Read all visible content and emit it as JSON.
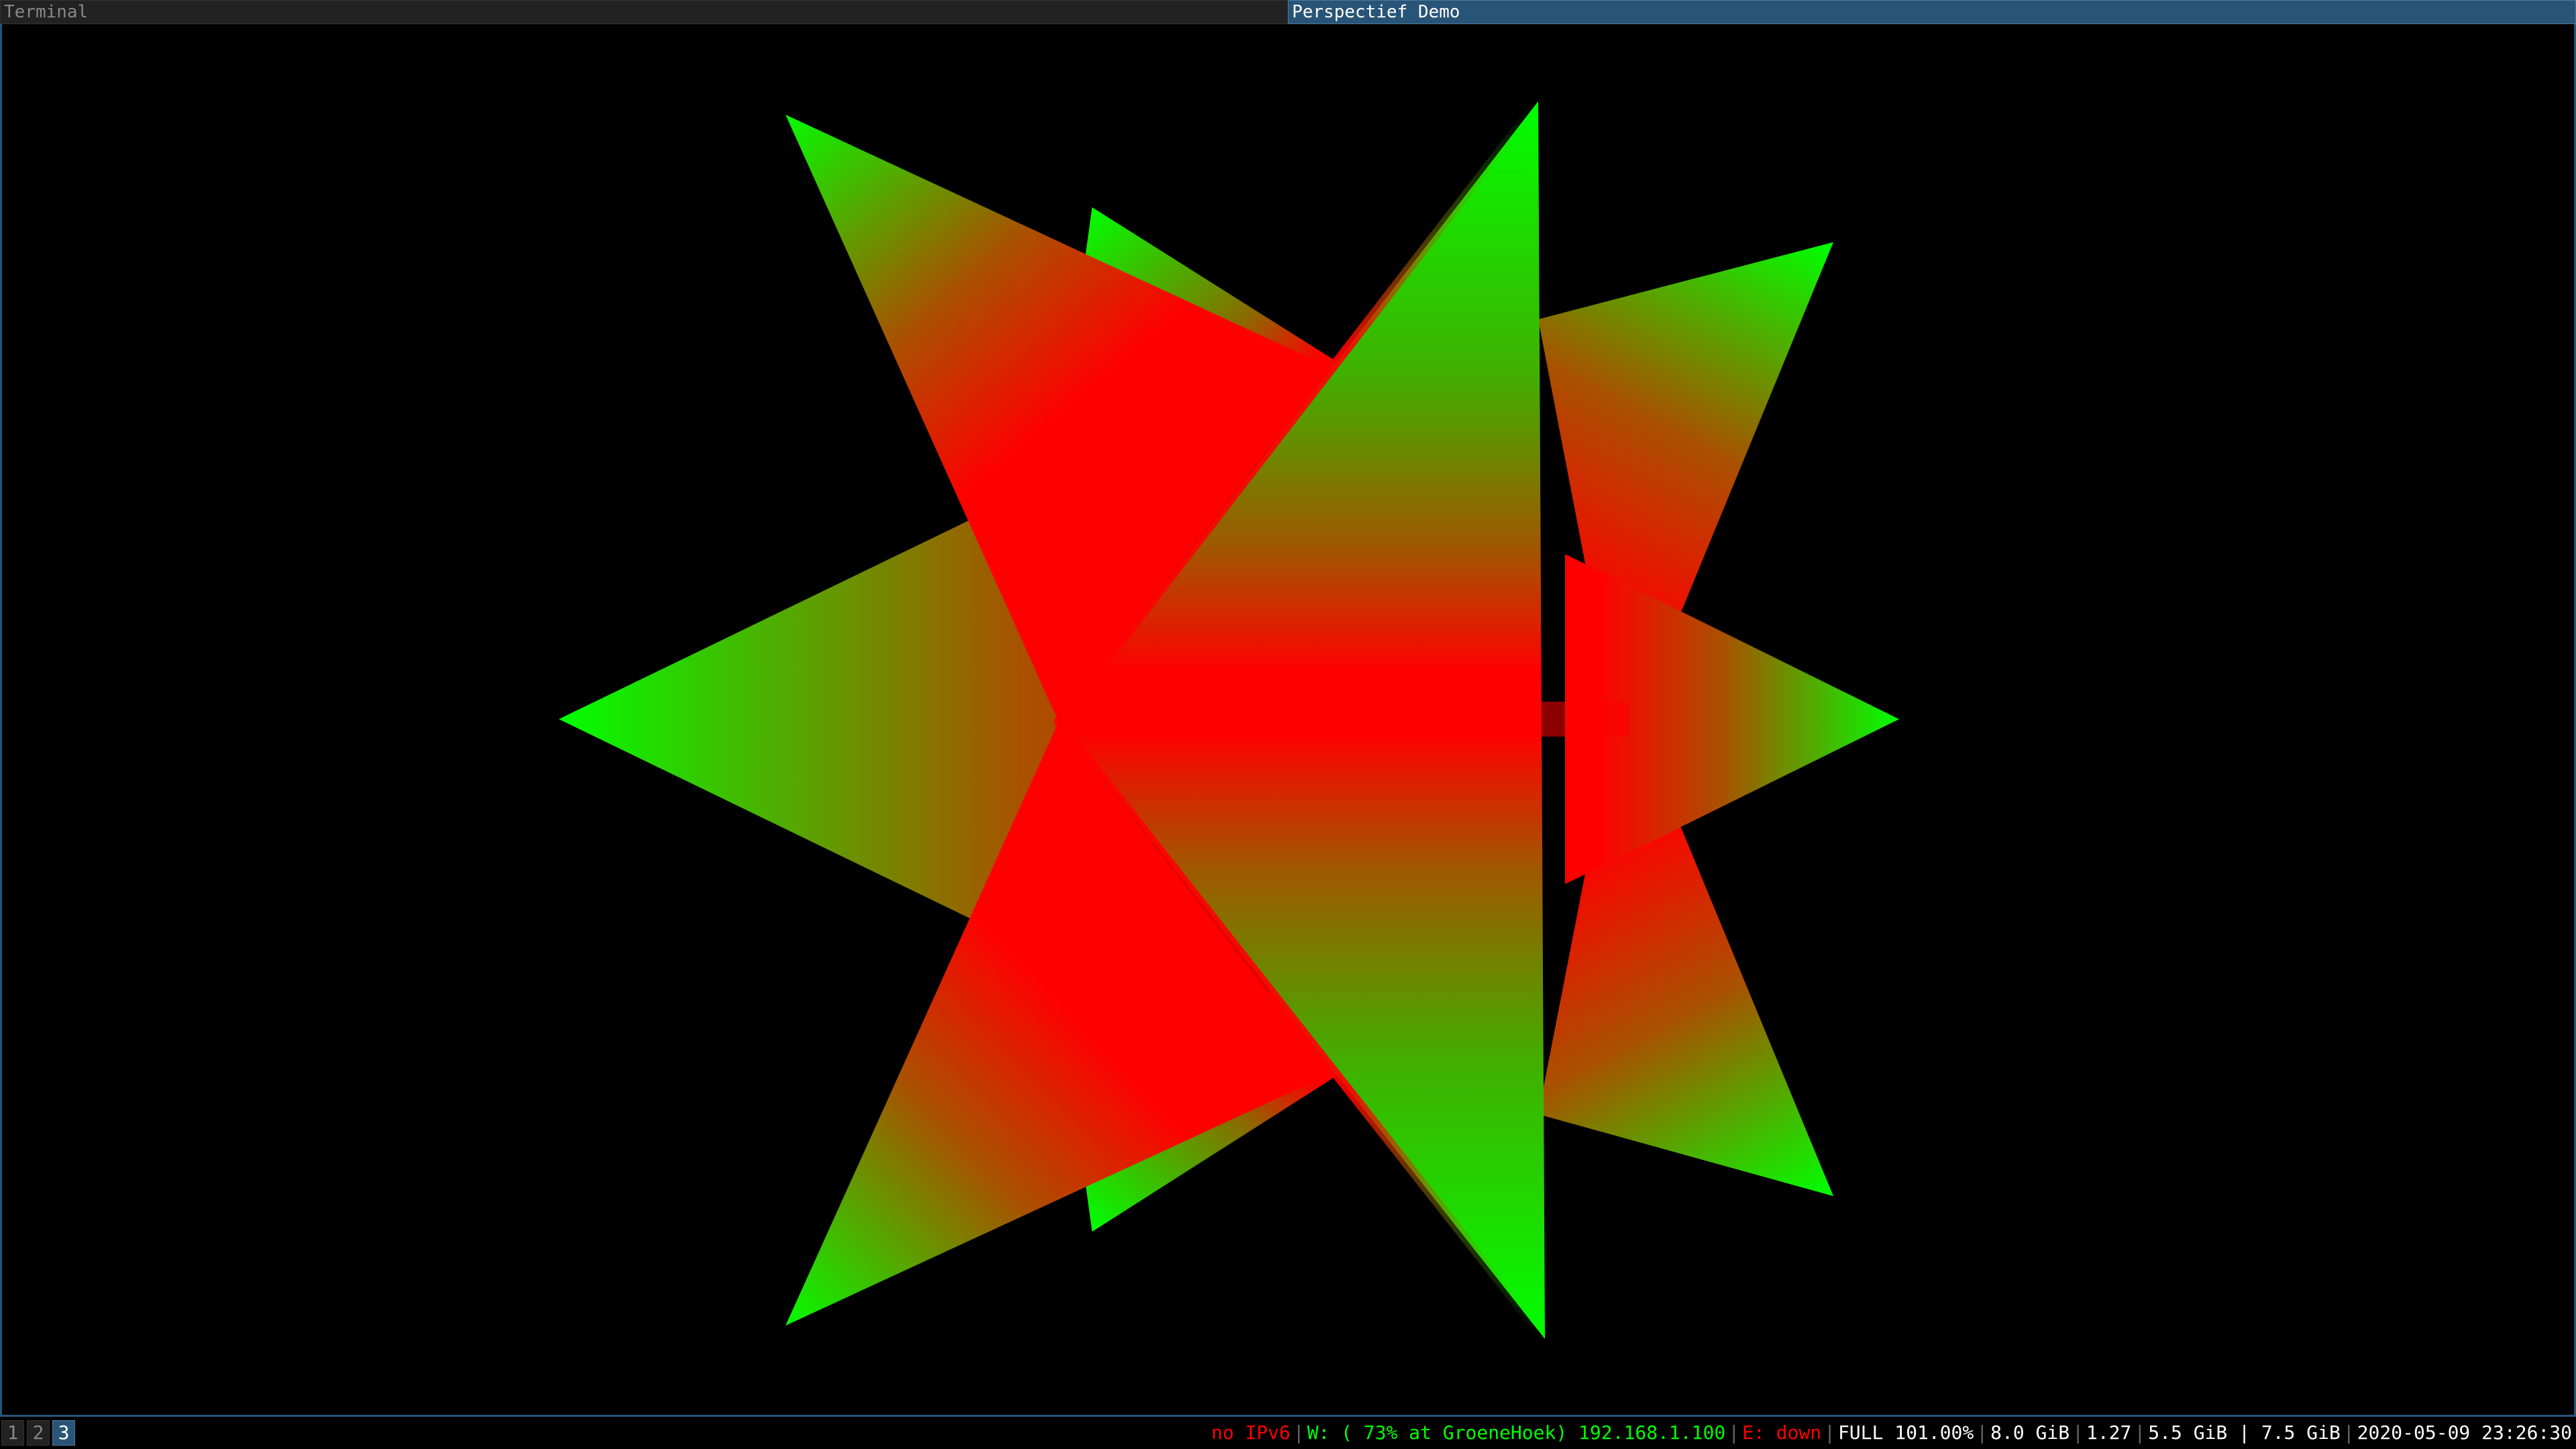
{
  "tabs": [
    {
      "title": "Terminal",
      "active": false
    },
    {
      "title": "Perspectief Demo",
      "active": true
    }
  ],
  "workspaces": [
    {
      "label": "1",
      "focused": false
    },
    {
      "label": "2",
      "focused": false
    },
    {
      "label": "3",
      "focused": true
    }
  ],
  "status": {
    "ipv6": "no IPv6",
    "wireless": "W: ( 73% at GroeneHoek) 192.168.1.100",
    "ethernet": "E: down",
    "battery": "FULL 101.00%",
    "disk": "8.0 GiB",
    "load": "1.27",
    "memory": "5.5 GiB | 7.5 GiB",
    "datetime": "2020-05-09 23:26:30"
  },
  "colors": {
    "bad": "#ff0000",
    "good": "#00ff00",
    "neutral": "#ffffff",
    "focused_bg": "#285577",
    "triangle_edge": "#00ff00",
    "triangle_center": "#ff0000"
  }
}
